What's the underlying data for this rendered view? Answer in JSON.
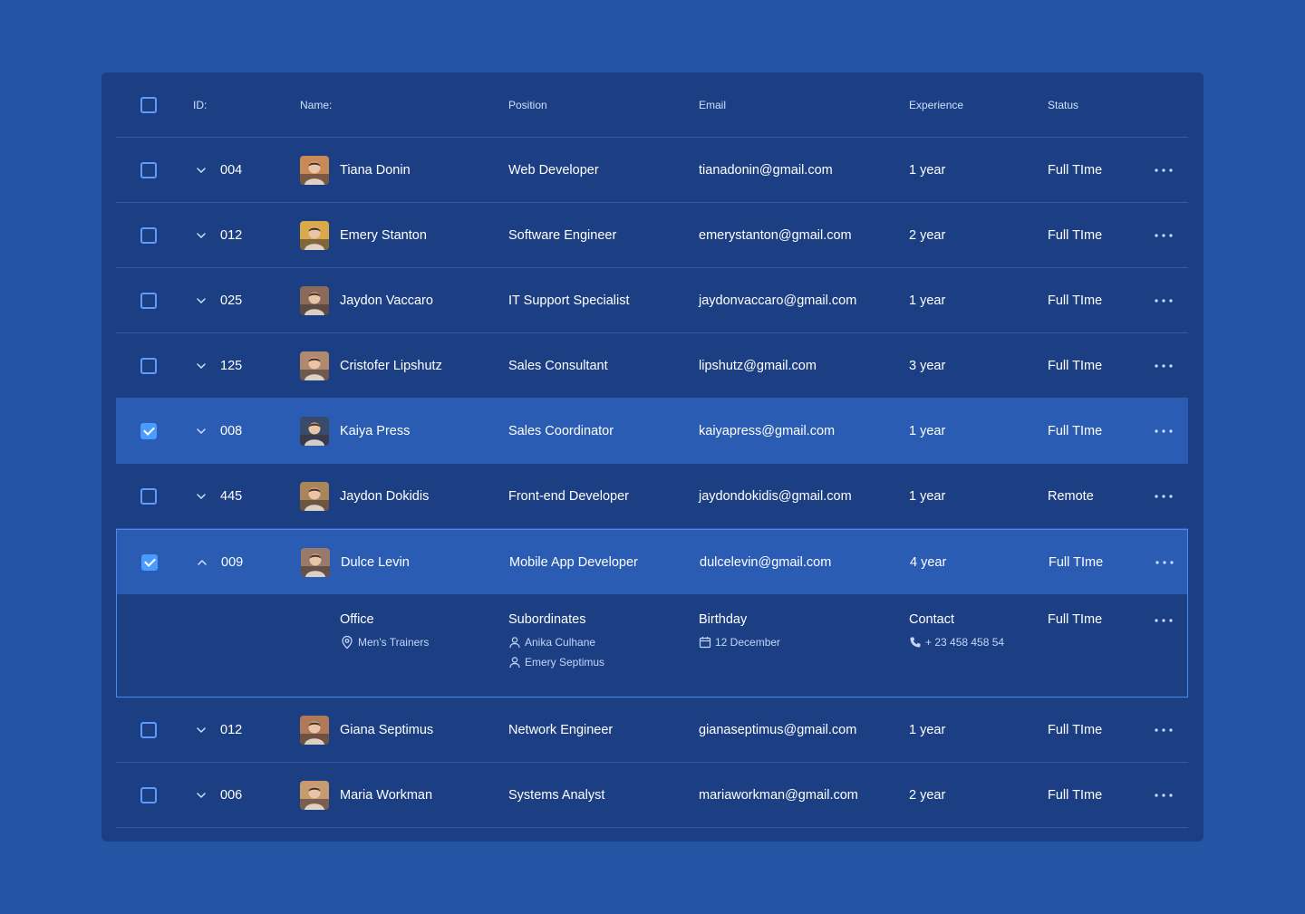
{
  "header": {
    "id": "ID:",
    "name": "Name:",
    "position": "Position",
    "email": "Email",
    "experience": "Experience",
    "status": "Status"
  },
  "rows": [
    {
      "id": "004",
      "name": "Tiana Donin",
      "position": "Web Developer",
      "email": "tianadonin@gmail.com",
      "experience": "1 year",
      "status": "Full TIme",
      "checked": false,
      "avatar_color": "#c98a5a"
    },
    {
      "id": "012",
      "name": "Emery Stanton",
      "position": "Software Engineer",
      "email": "emerystanton@gmail.com",
      "experience": "2 year",
      "status": "Full TIme",
      "checked": false,
      "avatar_color": "#d9a94a"
    },
    {
      "id": "025",
      "name": "Jaydon Vaccaro",
      "position": "IT Support Specialist",
      "email": "jaydonvaccaro@gmail.com",
      "experience": "1 year",
      "status": "Full TIme",
      "checked": false,
      "avatar_color": "#8a6a5a"
    },
    {
      "id": "125",
      "name": "Cristofer Lipshutz",
      "position": "Sales Consultant",
      "email": "lipshutz@gmail.com",
      "experience": "3 year",
      "status": "Full TIme",
      "checked": false,
      "avatar_color": "#b08a70"
    },
    {
      "id": "008",
      "name": "Kaiya Press",
      "position": "Sales Coordinator",
      "email": "kaiyapress@gmail.com",
      "experience": "1 year",
      "status": "Full TIme",
      "checked": true,
      "avatar_color": "#3a4a6a"
    },
    {
      "id": "445",
      "name": "Jaydon Dokidis",
      "position": "Front-end Developer",
      "email": "jaydondokidis@gmail.com",
      "experience": "1 year",
      "status": "Remote",
      "checked": false,
      "avatar_color": "#a8865a"
    }
  ],
  "expanded_row": {
    "id": "009",
    "name": "Dulce Levin",
    "position": "Mobile App Developer",
    "email": "dulcelevin@gmail.com",
    "experience": "4 year",
    "status": "Full TIme",
    "checked": true,
    "avatar_color": "#9a7a6a",
    "details": {
      "office_title": "Office",
      "office_value": "Men's Trainers",
      "subordinates_title": "Subordinates",
      "subordinates": [
        "Anika Culhane",
        "Emery Septimus"
      ],
      "birthday_title": "Birthday",
      "birthday_value": "12 December",
      "contact_title": "Contact",
      "contact_value": "+ 23 458 458 54",
      "status": "Full TIme"
    }
  },
  "rows_after": [
    {
      "id": "012",
      "name": "Giana Septimus",
      "position": "Network Engineer",
      "email": "gianaseptimus@gmail.com",
      "experience": "1 year",
      "status": "Full TIme",
      "checked": false,
      "avatar_color": "#b07a5a"
    },
    {
      "id": "006",
      "name": "Maria Workman",
      "position": "Systems Analyst",
      "email": "mariaworkman@gmail.com",
      "experience": "2 year",
      "status": "Full TIme",
      "checked": false,
      "avatar_color": "#c89a70"
    }
  ],
  "colors": {
    "background": "#2454a4",
    "card": "#1c3f84",
    "selected_row": "#2a5cb3",
    "accent": "#4a9bff"
  }
}
